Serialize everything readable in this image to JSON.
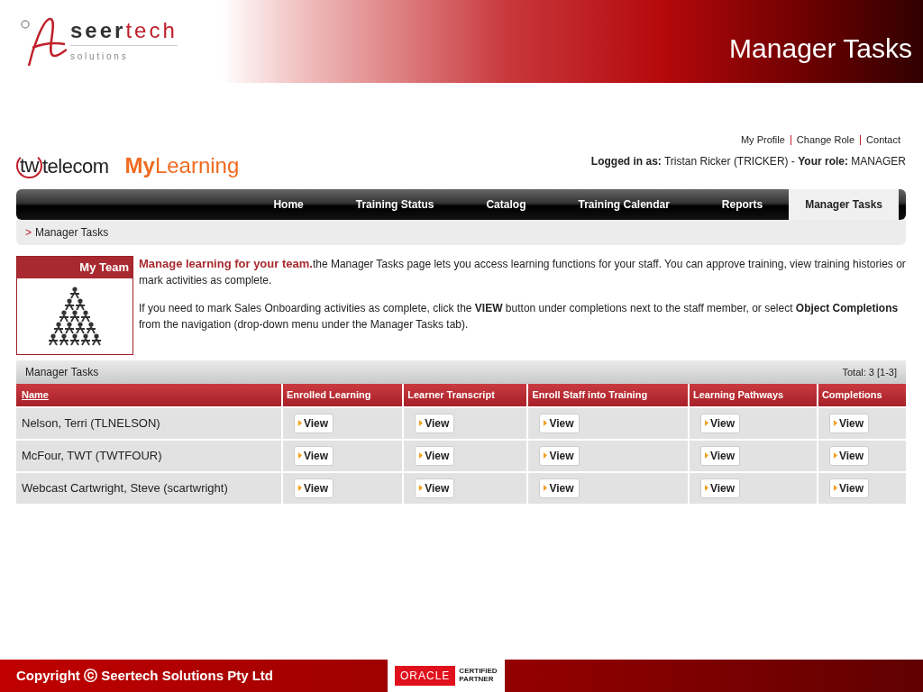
{
  "slide": {
    "logo": {
      "wordmark_dark": "seer",
      "wordmark_light": "tech",
      "tagline": "s o l u t i o n s"
    },
    "title": "Manager Tasks"
  },
  "header": {
    "brand": {
      "mark": "tw",
      "name": "telecom",
      "product_bold": "My",
      "product_rest": "Learning"
    },
    "top_links": [
      "My Profile",
      "Change Role",
      "Contact"
    ],
    "login": {
      "label": "Logged in as:",
      "user": "Tristan Ricker (TRICKER)",
      "separator": "-",
      "role_label": "Your role:",
      "role": "MANAGER"
    }
  },
  "nav": [
    {
      "label": "Home",
      "selected": false
    },
    {
      "label": "Training Status",
      "selected": false
    },
    {
      "label": "Catalog",
      "selected": false
    },
    {
      "label": "Training Calendar",
      "selected": false
    },
    {
      "label": "Reports",
      "selected": false
    },
    {
      "label": "Manager Tasks",
      "selected": true
    }
  ],
  "breadcrumb": {
    "marker": ">",
    "label": "Manager Tasks"
  },
  "intro": {
    "panel_title": "My Team",
    "lead": "Manage learning for your team.",
    "lead_text": "the Manager Tasks page lets you access learning functions for your staff. You can approve training, view training histories or mark activities as complete.",
    "paragraph": "If you need to mark Sales Onboarding activities as complete, click the **VIEW** button under completions next to the staff member, or select **Object Completions** from the navigation (drop-down menu under the Manager Tasks tab)."
  },
  "table": {
    "title": "Manager Tasks",
    "total": "Total: 3 [1-3]",
    "columns": [
      {
        "label": "Name",
        "link": true
      },
      {
        "label": "Enrolled Learning",
        "link": false
      },
      {
        "label": "Learner Transcript",
        "link": false
      },
      {
        "label": "Enroll Staff into Training",
        "link": false
      },
      {
        "label": "Learning Pathways",
        "link": false
      },
      {
        "label": "Completions",
        "link": false
      }
    ],
    "rows": [
      {
        "name": "Nelson, Terri (TLNELSON)",
        "buttons": [
          "View",
          "View",
          "View",
          "View",
          "View"
        ]
      },
      {
        "name": "McFour, TWT (TWTFOUR)",
        "buttons": [
          "View",
          "View",
          "View",
          "View",
          "View"
        ]
      },
      {
        "name": "Webcast Cartwright, Steve (scartwright)",
        "buttons": [
          "View",
          "View",
          "View",
          "View",
          "View"
        ]
      }
    ]
  },
  "footer": {
    "copyright": "Copyright ⓒ Seertech Solutions Pty Ltd",
    "badge": {
      "brand": "ORACLE",
      "line_1": "CERTIFIED",
      "line_2": "PARTNER"
    }
  }
}
